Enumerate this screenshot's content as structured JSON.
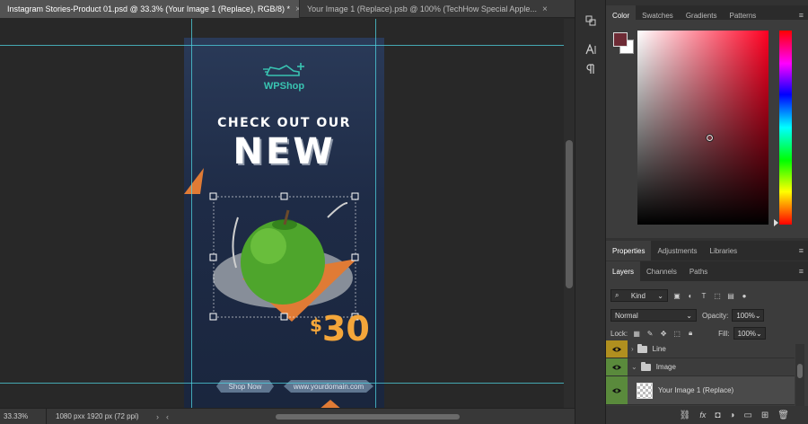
{
  "tabs": [
    {
      "label": "Instagram Stories-Product 01.psd @ 33.3% (Your Image 1 (Replace), RGB/8) *",
      "close": "×"
    },
    {
      "label": "Your Image 1 (Replace).psb @ 100% (TechHow Special Apple...",
      "close": "×"
    }
  ],
  "artboard": {
    "brand": "WPShop",
    "headline_1": "CHECK OUT OUR",
    "headline_2": "NEW",
    "price_currency": "$",
    "price_value": "30",
    "button_shop": "Shop Now",
    "button_url": "www.yourdomain.com",
    "colors": {
      "background": "#1f2c47",
      "accent": "#e07b35",
      "brand": "#39c4b2",
      "price": "#f4a63a"
    }
  },
  "status": {
    "zoom": "33.33%",
    "doc_info": "1080 pxx 1920 px (72 ppi)",
    "left_arrow": "‹",
    "right_arrow": "›"
  },
  "color_panel": {
    "tabs": [
      "Color",
      "Swatches",
      "Gradients",
      "Patterns"
    ],
    "foreground": "#6e2b35",
    "background": "#ffffff",
    "menu": "≡"
  },
  "properties_tabs": [
    "Properties",
    "Adjustments",
    "Libraries"
  ],
  "layers_tabs": [
    "Layers",
    "Channels",
    "Paths"
  ],
  "layers": {
    "filter_kind": "Kind",
    "blend_mode": "Normal",
    "opacity_label": "Opacity:",
    "opacity_value": "100%",
    "lock_label": "Lock:",
    "fill_label": "Fill:",
    "fill_value": "100%",
    "items": [
      {
        "name": "Line",
        "type": "group",
        "visible": true,
        "collapsed": true
      },
      {
        "name": "Image",
        "type": "group",
        "visible": true,
        "collapsed": false
      },
      {
        "name": "Your Image 1 (Replace)",
        "type": "smart-object",
        "visible": true,
        "selected": true
      }
    ],
    "footer_icons": [
      "link-icon",
      "fx-icon",
      "mask-icon",
      "adjustment-icon",
      "folder-icon",
      "new-layer-icon",
      "trash-icon"
    ]
  },
  "tool_strip": [
    "history-icon",
    "character-icon",
    "paragraph-icon"
  ]
}
